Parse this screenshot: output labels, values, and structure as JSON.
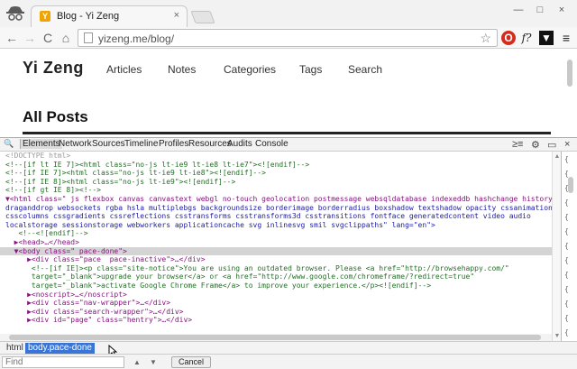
{
  "browser": {
    "tab_title": "Blog - Yi Zeng",
    "tab_close": "×",
    "favicon_letter": "Y",
    "url": "yizeng.me/blog/",
    "back_glyph": "←",
    "forward_glyph": "→",
    "reload_glyph": "C",
    "home_glyph": "⌂",
    "star_glyph": "☆",
    "extensions": [
      "opera-icon",
      "function-icon",
      "bookmark-icon",
      "menu-icon"
    ],
    "ext_glyphs": [
      "O",
      "f?",
      "▼",
      "≡"
    ],
    "window_buttons": [
      "—",
      "□",
      "×"
    ]
  },
  "site": {
    "logo": "Yi Zeng",
    "nav": [
      "Articles",
      "Notes",
      "Categories",
      "Tags",
      "Search"
    ],
    "page_title": "All Posts"
  },
  "devtools": {
    "search_glyph": "🔍",
    "tabs": [
      "Elements",
      "Network",
      "Sources",
      "Timeline",
      "Profiles",
      "Resources",
      "Audits",
      "Console"
    ],
    "active_tab": "Elements",
    "right_icons": [
      "≥≡",
      "⚙",
      "▭",
      "×"
    ],
    "breadcrumbs": [
      "html",
      "body.pace-done"
    ],
    "active_breadcrumb": "body.pace-done",
    "find_placeholder": "Find",
    "find_prev": "▲",
    "find_next": "▼",
    "cancel_label": "Cancel",
    "side_brackets": [
      "{",
      "{",
      "{",
      "{",
      "{",
      "{",
      "{",
      "{",
      "{",
      "{",
      "{",
      "{",
      "{"
    ],
    "lines": [
      "<!DOCTYPE html>",
      "<!--[if lt IE 7]><html class=\"no-js lt-ie9 lt-ie8 lt-ie7\"><![endif]-->",
      "<!--[if IE 7]><html class=\"no-js lt-ie9 lt-ie8\"><![endif]-->",
      "<!--[if IE 8]><html class=\"no-js lt-ie9\"><![endif]-->",
      "<!--[if gt IE 8]><!-->",
      "▼<html class=\" js flexbox canvas canvastext webgl no-touch geolocation postmessage websqldatabase indexeddb hashchange history",
      "draganddrop websockets rgba hsla multiplebgs backgroundsize borderimage borderradius boxshadow textshadow opacity cssanimations",
      "csscolumns cssgradients cssreflections csstransforms csstransforms3d csstransitions fontface generatedcontent video audio",
      "localstorage sessionstorage webworkers applicationcache svg inlinesvg smil svgclippaths\" lang=\"en\">",
      "   <!--<![endif]-->",
      "  ▶<head>…</head>",
      "  ▼<body class=\" pace-done\">",
      "     ▶<div class=\"pace  pace-inactive\">…</div>",
      "      <!--[if IE]><p class=\"site-notice\">You are using an outdated browser. Please <a href=\"http://browsehappy.com/\"",
      "      target=\"_blank\">upgrade your browser</a> or <a href=\"http://www.google.com/chromeframe/?redirect=true\"",
      "      target=\"_blank\">activate Google Chrome Frame</a> to improve your experience.</p><![endif]-->",
      "     ▶<noscript>…</noscript>",
      "     ▶<div class=\"nav-wrapper\">…</div>",
      "     ▶<div class=\"search-wrapper\">…</div>",
      "     ▶<div id=\"page\" class=\"hentry\">…</div>"
    ]
  }
}
